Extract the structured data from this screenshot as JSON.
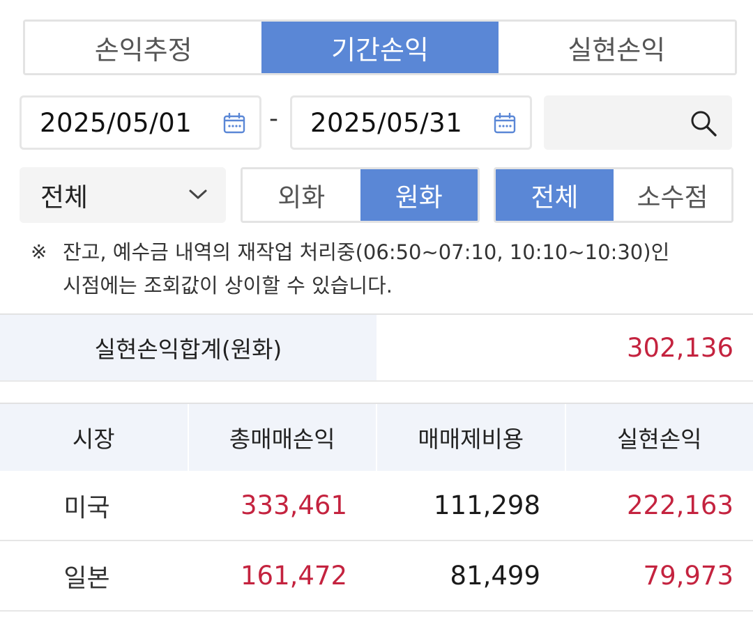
{
  "tabs": [
    {
      "label": "손익추정",
      "active": false
    },
    {
      "label": "기간손익",
      "active": true
    },
    {
      "label": "실현손익",
      "active": false
    }
  ],
  "date_range": {
    "start": "2025/05/01",
    "separator": "-",
    "end": "2025/05/31"
  },
  "filters": {
    "account_select": "전체",
    "currency": [
      {
        "label": "외화",
        "active": false
      },
      {
        "label": "원화",
        "active": true
      }
    ],
    "decimal": [
      {
        "label": "전체",
        "active": true
      },
      {
        "label": "소수점",
        "active": false
      }
    ]
  },
  "notice": {
    "mark": "※",
    "line1": "잔고, 예수금 내역의 재작업 처리중(06:50~07:10, 10:10~10:30)인",
    "line2": "시점에는 조회값이 상이할 수 있습니다."
  },
  "summary": {
    "label": "실현손익합계(원화)",
    "value": "302,136"
  },
  "table": {
    "headers": [
      "시장",
      "총매매손익",
      "매매제비용",
      "실현손익"
    ],
    "rows": [
      {
        "market": "미국",
        "gross": "333,461",
        "cost": "111,298",
        "realized": "222,163"
      },
      {
        "market": "일본",
        "gross": "161,472",
        "cost": "81,499",
        "realized": "79,973"
      }
    ]
  },
  "colors": {
    "accent": "#5a87d6",
    "profit_red": "#c4233f",
    "header_bg": "#f1f4fa"
  }
}
